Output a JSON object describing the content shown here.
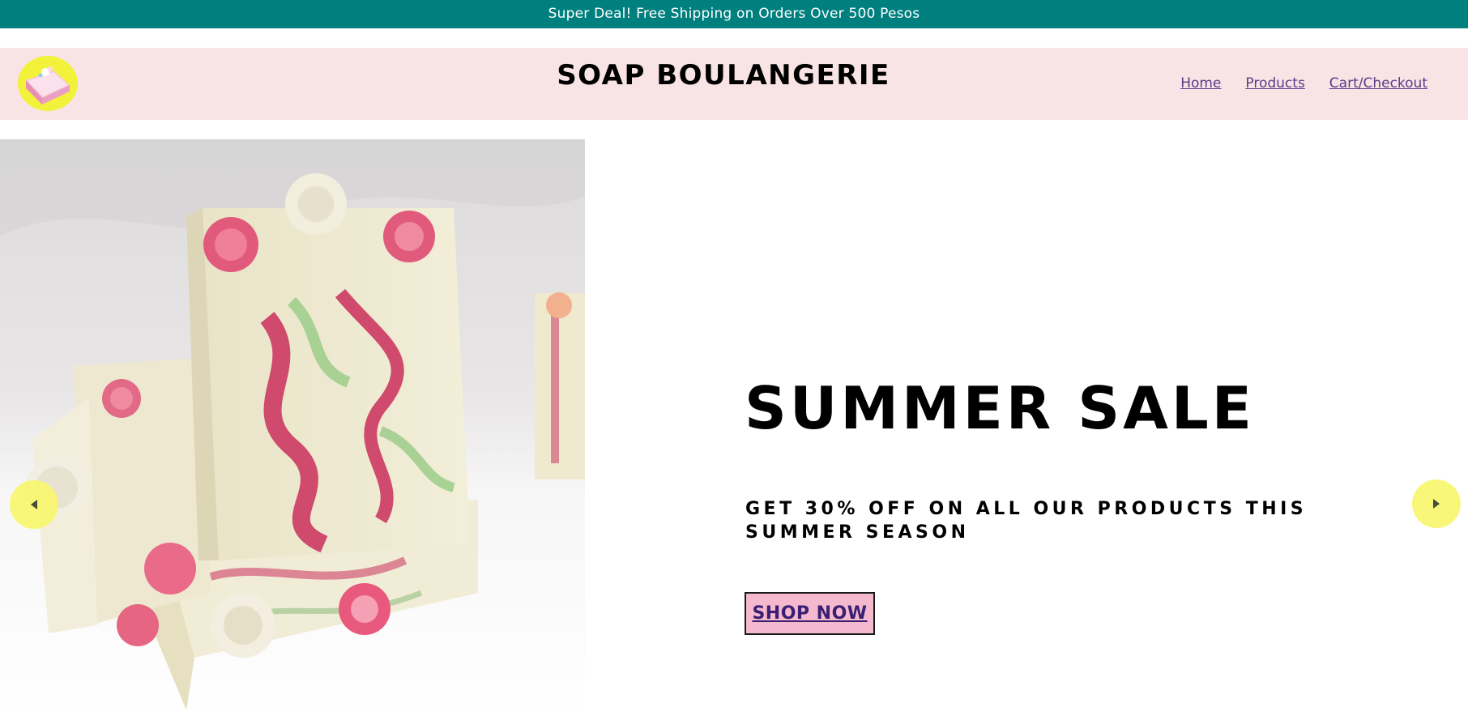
{
  "announcement": {
    "text": "Super Deal! Free Shipping on Orders Over 500 Pesos"
  },
  "header": {
    "logo_icon": "cake-slice-logo",
    "title": "SOAP BOULANGERIE",
    "nav": [
      {
        "label": "Home"
      },
      {
        "label": "Products"
      },
      {
        "label": "Cart/Checkout"
      }
    ]
  },
  "hero": {
    "image_icon": "soap-bars-photo",
    "title": "SUMMER SALE",
    "subtitle": "GET 30% OFF ON ALL OUR PRODUCTS THIS SUMMER SEASON",
    "cta_label": "SHOP NOW",
    "prev_icon": "chevron-left-icon",
    "next_icon": "chevron-right-icon"
  },
  "colors": {
    "announcement_bg": "#007f7f",
    "header_bg": "#f8e4e4",
    "cta_bg": "#f5b9cf",
    "arrow_bg": "#f8f66e",
    "link": "#5a3a8a"
  }
}
